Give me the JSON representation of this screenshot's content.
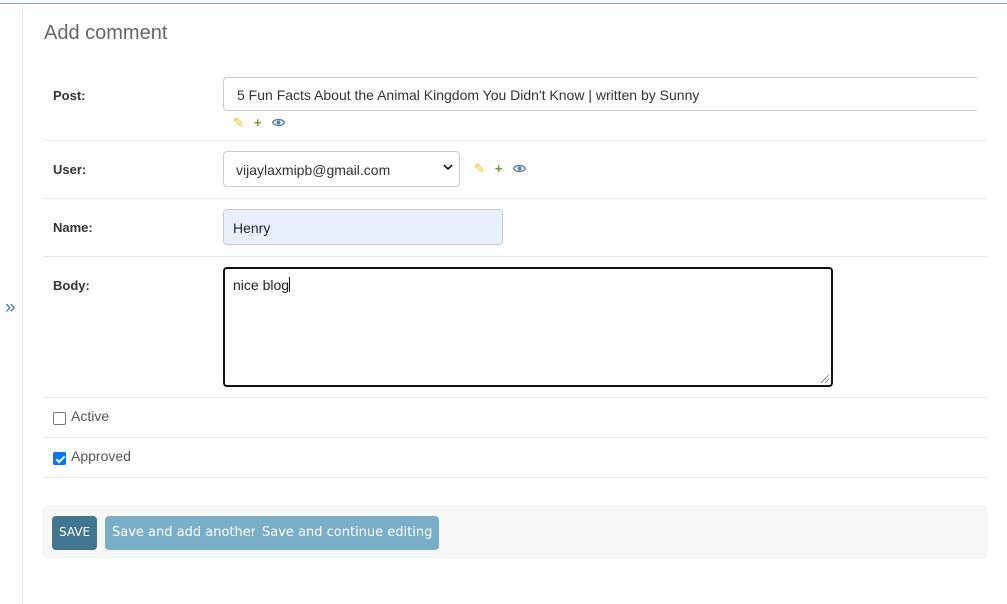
{
  "page": {
    "title": "Add comment"
  },
  "nav": {
    "toggle_label": "»"
  },
  "form": {
    "post": {
      "label": "Post:",
      "value": "5 Fun Facts About the Animal Kingdom You Didn't Know | written by Sunny",
      "icons": [
        "pencil-icon",
        "plus-icon",
        "eye-icon"
      ]
    },
    "user": {
      "label": "User:",
      "value": "vijaylaxmipb@gmail.com",
      "icons": [
        "pencil-icon",
        "plus-icon",
        "eye-icon"
      ]
    },
    "name": {
      "label": "Name:",
      "value": "Henry"
    },
    "body": {
      "label": "Body:",
      "value": "nice blog"
    },
    "active": {
      "label": "Active",
      "checked": false
    },
    "approved": {
      "label": "Approved",
      "checked": true
    }
  },
  "actions": {
    "save": "SAVE",
    "save_add_another": "Save and add another",
    "save_continue": "Save and continue editing"
  },
  "colors": {
    "header_line": "#79aec8",
    "primary_button": "#417690",
    "secondary_button": "#79aec8",
    "edit_icon": "#efb80b",
    "add_icon": "#5fa225",
    "view_icon": "#5b80b2",
    "autofill_bg": "#e8f0fe"
  }
}
